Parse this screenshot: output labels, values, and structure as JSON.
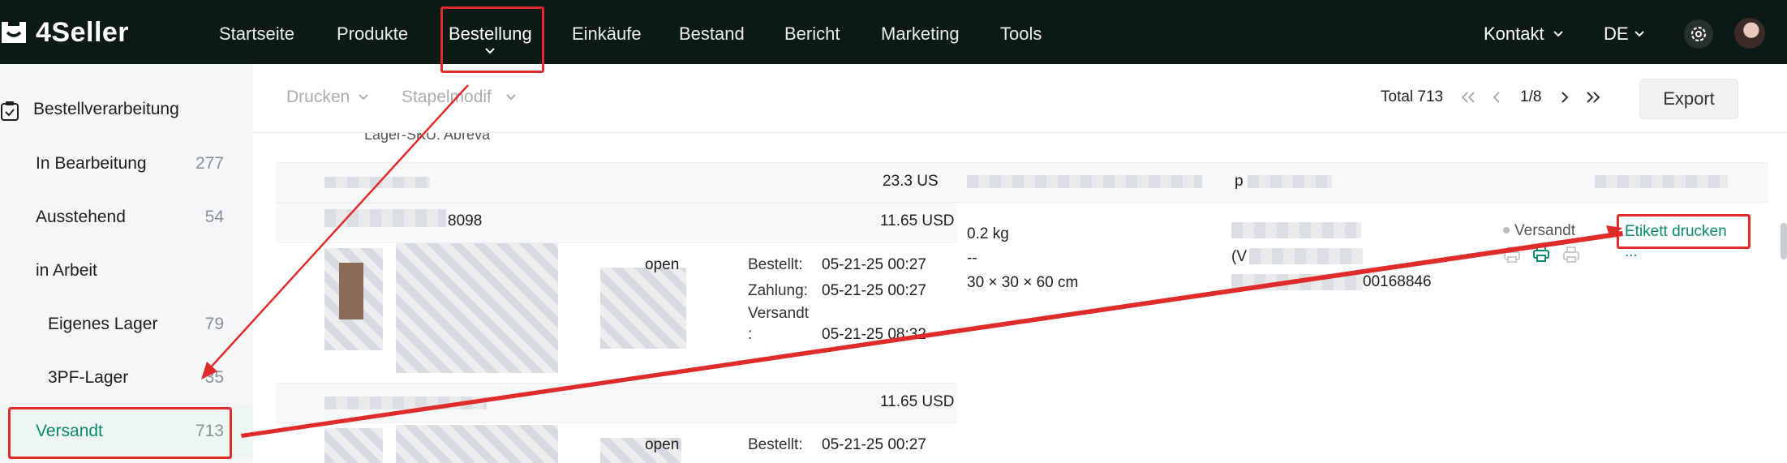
{
  "header": {
    "logo_text": "4Seller",
    "nav": [
      "Startseite",
      "Produkte",
      "Bestellung",
      "Einkäufe",
      "Bestand",
      "Bericht",
      "Marketing",
      "Tools"
    ],
    "active_nav": "Bestellung",
    "contact": "Kontakt",
    "language": "DE"
  },
  "sidebar": {
    "section_title": "Bestellverarbeitung",
    "items": [
      {
        "label": "In Bearbeitung",
        "count": "277"
      },
      {
        "label": "Ausstehend",
        "count": "54"
      },
      {
        "label": "in Arbeit",
        "count": ""
      },
      {
        "label": "Eigenes Lager",
        "count": "79"
      },
      {
        "label": "3PF-Lager",
        "count": "35"
      },
      {
        "label": "Versandt",
        "count": "713"
      }
    ],
    "active_item": "Versandt"
  },
  "toolbar": {
    "print_label": "Drucken",
    "batch_label": "Stapelmodif",
    "total_label": "Total 713",
    "page_indicator": "1/8",
    "export_label": "Export"
  },
  "content": {
    "partial_top_text": "Lager-SKU: Abreva",
    "order1": {
      "amount_partial": "23.3 US"
    },
    "order2": {
      "id_suffix": "8098",
      "amount": "11.65 USD",
      "weight": "0.2 kg",
      "dash": "--",
      "dimensions": "30 × 30 × 60 cm",
      "buyer_partial": "open",
      "tracking_partial": "(V",
      "tracking_suffix": "00168846",
      "dates": [
        {
          "label": "Bestellt:",
          "value": "05-21-25 00:27"
        },
        {
          "label": "Zahlung:",
          "value": "05-21-25 00:27"
        },
        {
          "label": "Versandt",
          "label2": ":",
          "value": "05-21-25 08:32"
        }
      ],
      "status": "Versandt",
      "print_label_action": "Etikett drucken",
      "more": "..."
    },
    "order3": {
      "amount": "11.65 USD",
      "buyer_partial": "open",
      "dates": [
        {
          "label": "Bestellt:",
          "value": "05-21-25 00:27"
        }
      ]
    },
    "partial_p": "p"
  },
  "colors": {
    "topbar_bg": "#0c1a17",
    "accent_green": "#0a8a6a",
    "annotation_red": "#e02b2b"
  }
}
